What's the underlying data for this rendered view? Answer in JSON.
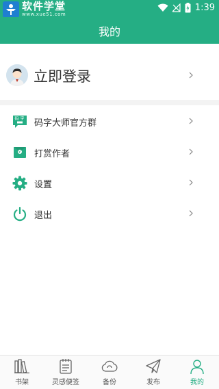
{
  "status_bar": {
    "brand_title": "软件学堂",
    "brand_url": "www.xue51.com",
    "time": "1:39",
    "icons": [
      "wifi-icon",
      "no-signal-icon",
      "battery-charging-icon"
    ]
  },
  "header": {
    "title": "我的"
  },
  "login": {
    "label": "立即登录",
    "icon": "avatar-icon"
  },
  "menu": [
    {
      "label": "码字大师官方群",
      "icon": "chat-group-icon"
    },
    {
      "label": "打赏作者",
      "icon": "red-envelope-icon"
    },
    {
      "label": "设置",
      "icon": "gear-icon"
    },
    {
      "label": "退出",
      "icon": "power-icon"
    }
  ],
  "tabs": [
    {
      "label": "书架",
      "icon": "bookshelf-icon",
      "active": false
    },
    {
      "label": "灵感便签",
      "icon": "notepad-icon",
      "active": false
    },
    {
      "label": "备份",
      "icon": "cloud-icon",
      "active": false
    },
    {
      "label": "发布",
      "icon": "send-icon",
      "active": false
    },
    {
      "label": "我的",
      "icon": "person-icon",
      "active": true
    }
  ],
  "colors": {
    "accent": "#25ae84",
    "text": "#333333",
    "divider": "#f3f3f3"
  }
}
